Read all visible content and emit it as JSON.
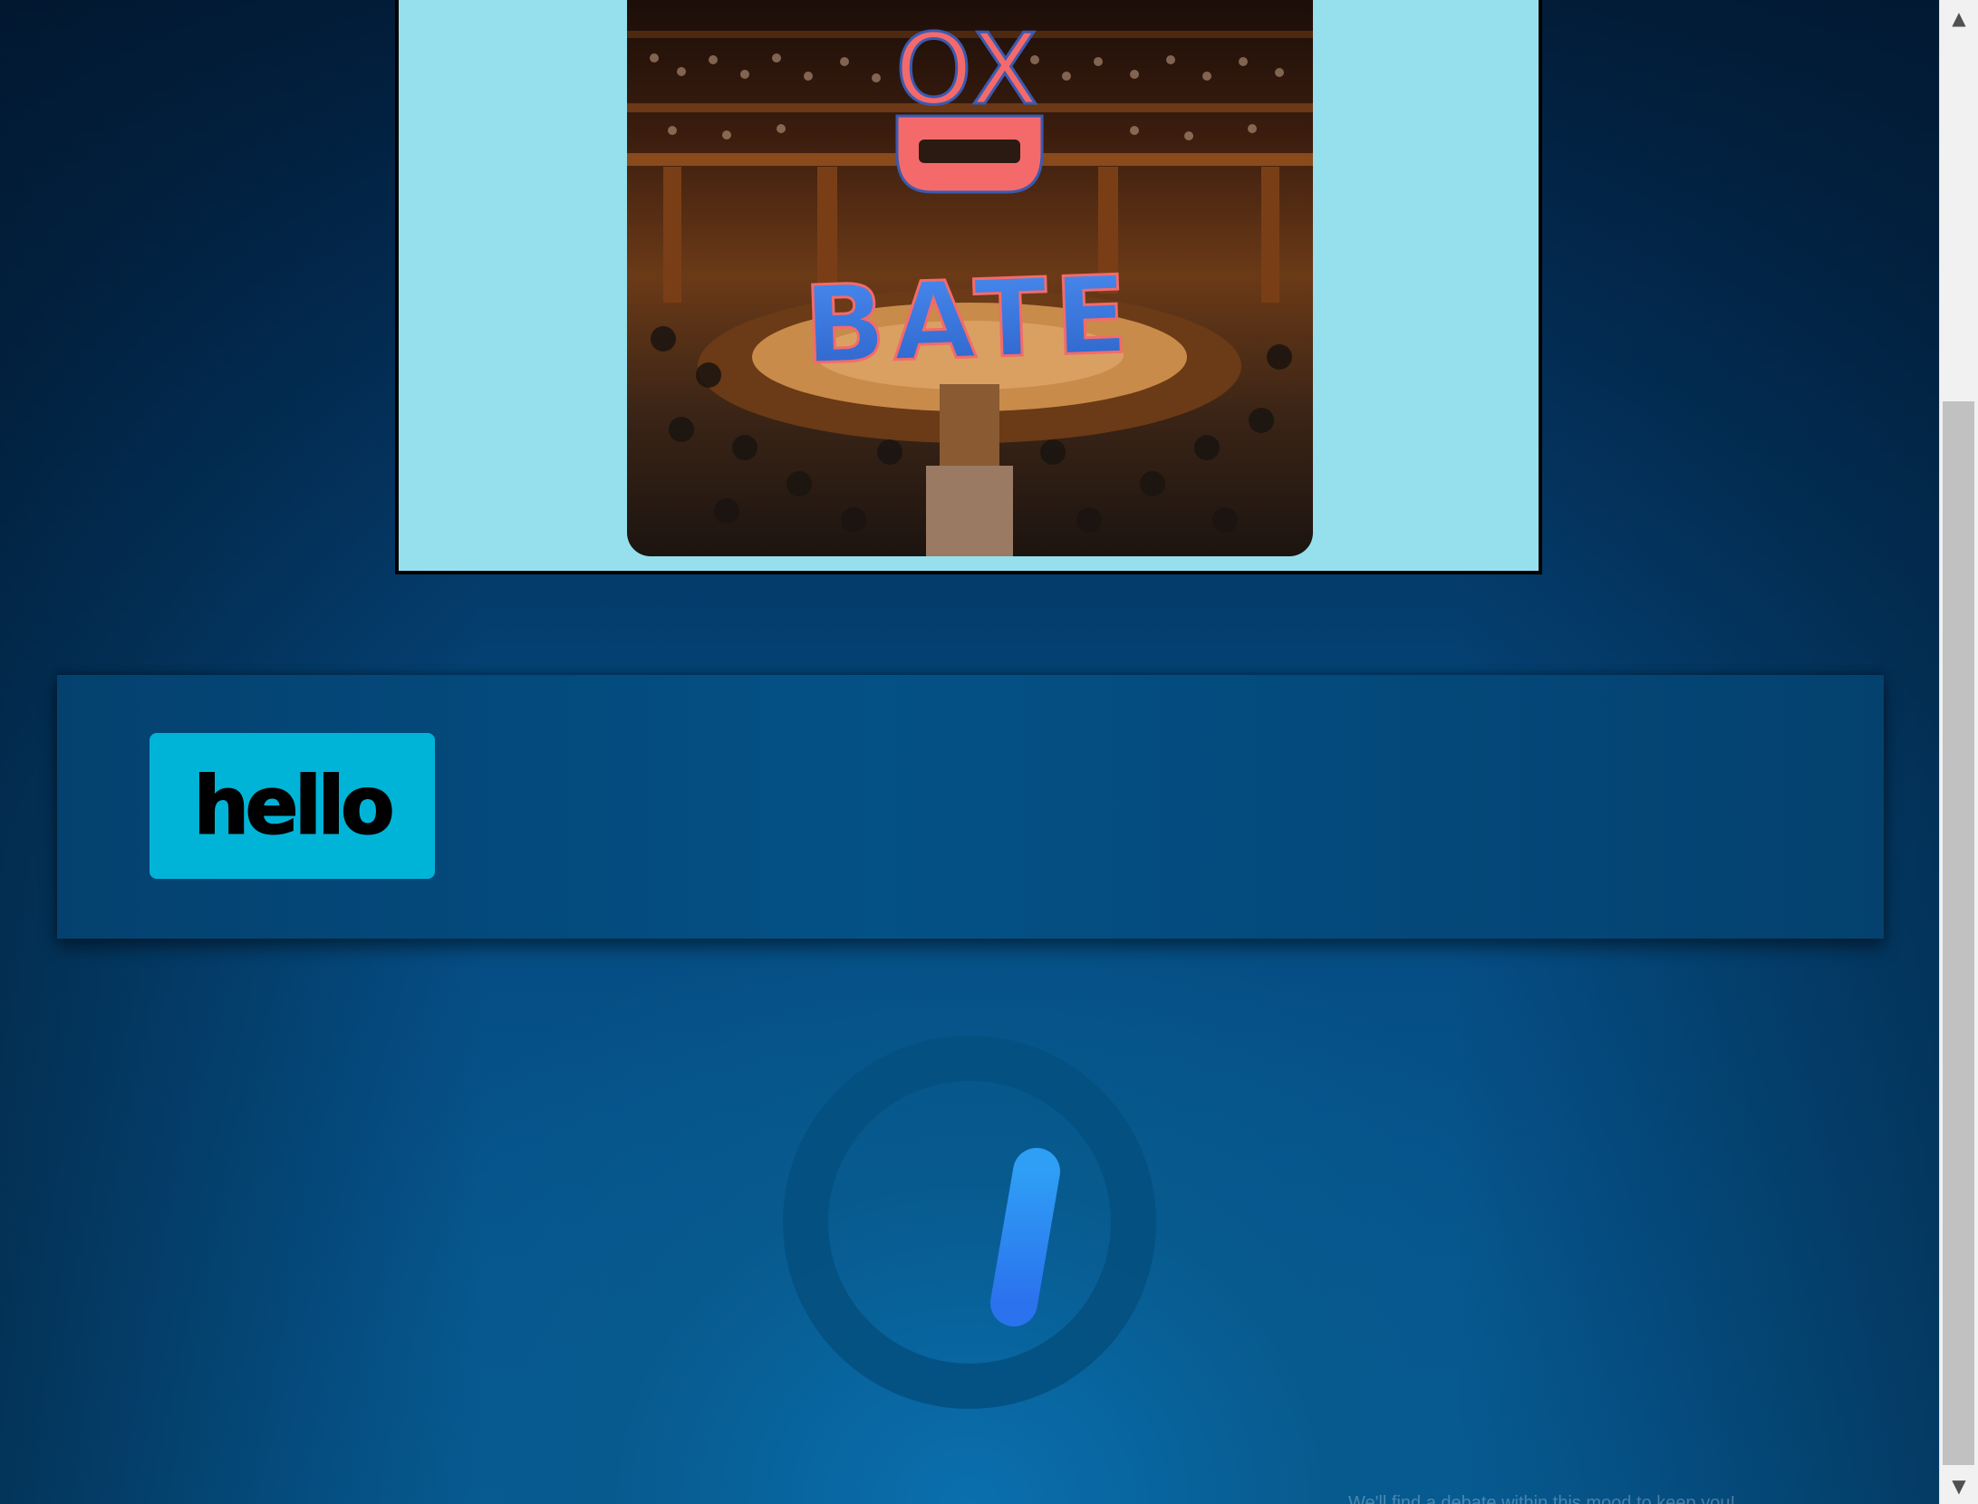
{
  "logo": {
    "line1": "OX",
    "line2": "BATE"
  },
  "hello_button": {
    "label": "hello"
  },
  "footer": {
    "text": "We'll find a debate within this mood to keep you!"
  },
  "colors": {
    "card_background": "#96e0ee",
    "button_background": "#00b4d8",
    "spinner_accent": "#2a8cf0",
    "logo_ox": "#f46a6a",
    "logo_bate": "#3a7fe0"
  },
  "icons": {
    "spinner": "loading-spinner-icon",
    "scroll_up": "chevron-up-icon",
    "scroll_down": "chevron-down-icon"
  }
}
